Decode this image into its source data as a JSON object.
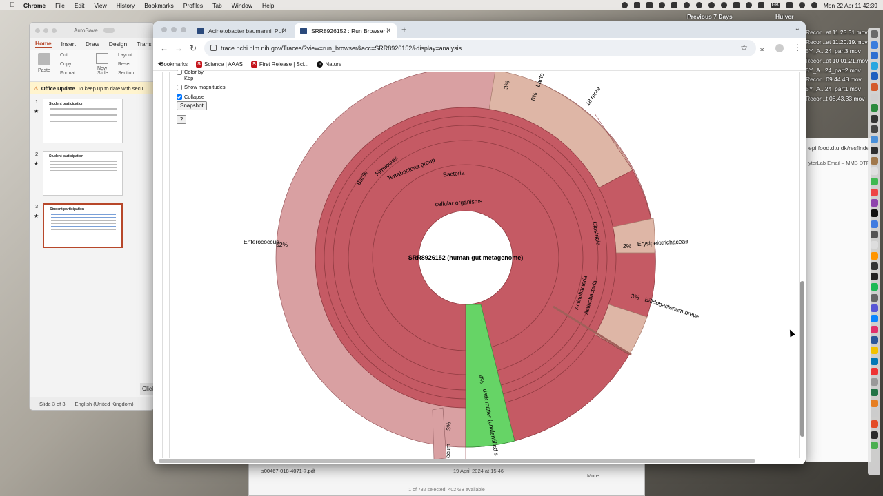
{
  "menubar": {
    "app_name": "Chrome",
    "items": [
      "File",
      "Edit",
      "View",
      "History",
      "Bookmarks",
      "Profiles",
      "Tab",
      "Window",
      "Help"
    ],
    "gb_label": "GB",
    "clock": "Mon 22 Apr  11:42:39"
  },
  "desktop": {
    "previous_label": "Previous 7 Days",
    "hulver_label": "Hulver",
    "files": [
      "Recor...at 11.23.31.mov",
      "Recor...at 11.20.19.mov",
      "5Y_A...24_part3.mov",
      "Recor...at 10.01.21.mov",
      "5Y_A...24_part2.mov",
      "Recor...09.44.48.mov",
      "5Y_A...24_part1.mov",
      "Recor...t 08.43.33.mov"
    ],
    "bg_browser_url": "epi.food.dtu.dk/resfinde",
    "bg_browser_bookmarks": "yterLab    Email – MMB DTF"
  },
  "powerpoint": {
    "autosave": "AutoSave",
    "tabs": [
      "Home",
      "Insert",
      "Draw",
      "Design",
      "Trans"
    ],
    "ribbon": {
      "paste": "Paste",
      "cut": "Cut",
      "copy": "Copy",
      "format": "Format",
      "new_slide": "New Slide",
      "layout": "Layout",
      "reset": "Reset",
      "section": "Section"
    },
    "notice_title": "Office Update",
    "notice_text": "To keep up to date with secu",
    "slides": [
      {
        "num": "1",
        "title": "Student participation"
      },
      {
        "num": "2",
        "title": "Student participation"
      },
      {
        "num": "3",
        "title": "Student participation"
      }
    ],
    "status_slide": "Slide 3 of 3",
    "status_lang": "English (United Kingdom)",
    "click_snip": "Click"
  },
  "finder": {
    "file": "s00467-018-4071-7.pdf",
    "date": "19 April 2024 at 15:46",
    "more": "More...",
    "footer": "1 of 732 selected, 402 GB available"
  },
  "chrome": {
    "tabs": [
      {
        "title": "Acinetobacter baumannii Pul",
        "active": false
      },
      {
        "title": "SRR8926152 : Run Browser :",
        "active": true
      }
    ],
    "url": "trace.ncbi.nlm.nih.gov/Traces/?view=run_browser&acc=SRR8926152&display=analysis",
    "bookmarks": [
      {
        "label": "Bookmarks",
        "icon": "star-icon"
      },
      {
        "label": "Science | AAAS",
        "icon": "science-favicon"
      },
      {
        "label": "First Release | Sci...",
        "icon": "science-favicon"
      },
      {
        "label": "Nature",
        "icon": "nature-favicon"
      }
    ]
  },
  "controls": {
    "color_by": "Color by",
    "kbp": "Kbp",
    "show_magnitudes": "Show magnitudes",
    "collapse": "Collapse",
    "snapshot": "Snapshot",
    "help": "?"
  },
  "krona": {
    "center_label": "SRR8926152 (human gut metagenome)",
    "labels": {
      "cellular": "cellular organisms",
      "bacteria": "Bacteria",
      "terrabacteria": "Terrabacteria group",
      "firmicutes": "Firmicutes",
      "bacilli": "Bacilli",
      "enterococcus": "Enterococcus",
      "enterococcus_pct": "52%",
      "clostridia": "Clostridia",
      "erysipelotrichaceae": "Erysipelotrichaceae",
      "erysipelo_pct": "2%",
      "actinobacteria1": "Actinobacteria",
      "actinobacteria2": "Actinobacteria",
      "bifido": "Bifidobacterium breve",
      "bifido_pct": "3%",
      "lacto": "Lacto",
      "lacto_pct": "8%",
      "l_pct": "3%",
      "more": "18 more",
      "dark_matter": "dark matter (unidentified s",
      "dark_pct": "4%",
      "faecium": "ecum",
      "faecium_pct": "3%"
    },
    "colors": {
      "main": "#c55a64",
      "light": "#d9a0a2",
      "tan": "#deb6a6",
      "green": "#66d466"
    }
  }
}
